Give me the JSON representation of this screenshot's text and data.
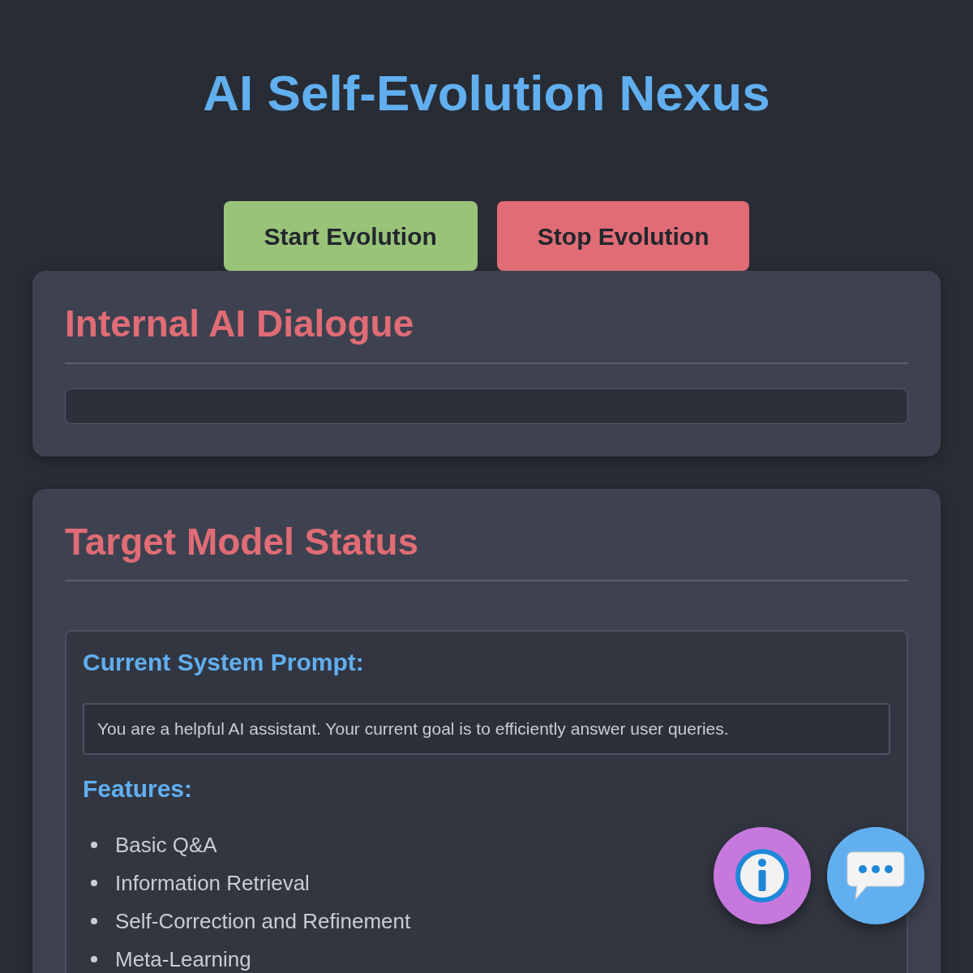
{
  "title": "AI Self-Evolution Nexus",
  "buttons": [
    {
      "label": "Start Evolution",
      "kind": "start"
    },
    {
      "label": "Stop Evolution",
      "kind": "stop"
    }
  ],
  "dialogue": {
    "heading": "Internal AI Dialogue"
  },
  "status": {
    "heading": "Target Model Status",
    "prompt_label": "Current System Prompt:",
    "prompt": "You are a helpful AI assistant. Your current goal is to efficiently answer user queries.",
    "features_label": "Features:",
    "features": [
      "Basic Q&A",
      "Information Retrieval",
      "Self-Correction and Refinement",
      "Meta-Learning"
    ]
  }
}
